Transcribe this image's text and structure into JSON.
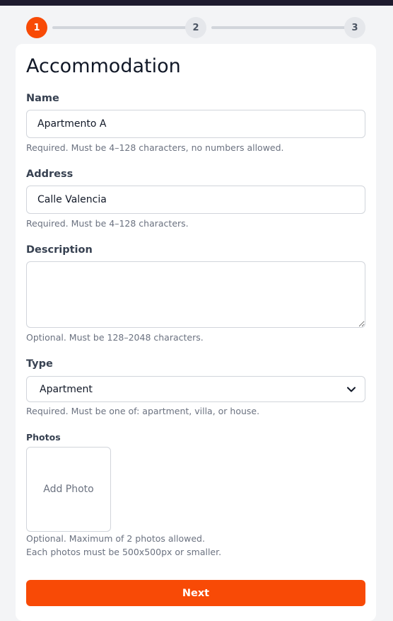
{
  "stepper": {
    "steps": [
      {
        "number": "1",
        "state": "active"
      },
      {
        "number": "2",
        "state": "inactive"
      },
      {
        "number": "3",
        "state": "inactive"
      }
    ]
  },
  "form": {
    "title": "Accommodation",
    "name": {
      "label": "Name",
      "value": "Apartmento A",
      "hint": "Required. Must be 4–128 characters, no numbers allowed."
    },
    "address": {
      "label": "Address",
      "value": "Calle Valencia",
      "hint": "Required. Must be 4–128 characters."
    },
    "description": {
      "label": "Description",
      "value": "",
      "hint": "Optional. Must be 128–2048 characters."
    },
    "type": {
      "label": "Type",
      "value": "Apartment",
      "hint": "Required. Must be one of: apartment, villa, or house."
    },
    "photos": {
      "label": "Photos",
      "add_label": "Add Photo",
      "hint_line1": "Optional. Maximum of 2 photos allowed.",
      "hint_line2": "Each photos must be 500x500px or smaller."
    },
    "next_label": "Next"
  },
  "colors": {
    "accent": "#f84a06",
    "topbar": "#1e1b2e",
    "border": "#d1d5db",
    "hint_text": "#6b7280"
  },
  "icons": {
    "select": "chevron-down-icon",
    "textarea": "resize-grip-icon"
  }
}
